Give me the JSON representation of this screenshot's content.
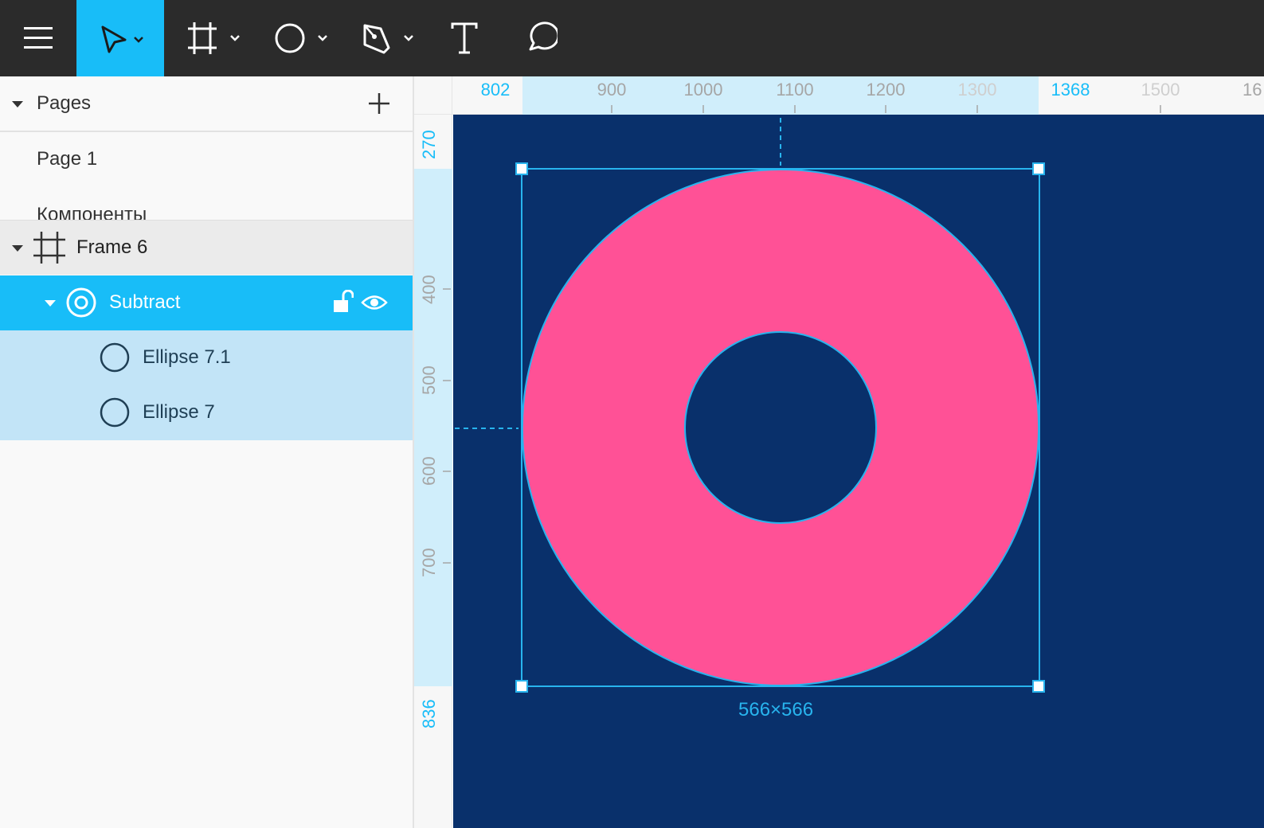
{
  "toolbar": {
    "tools": [
      {
        "name": "menu-icon"
      },
      {
        "name": "move-tool-icon",
        "active": true
      },
      {
        "name": "frame-tool-icon"
      },
      {
        "name": "ellipse-tool-icon"
      },
      {
        "name": "pen-tool-icon"
      },
      {
        "name": "text-tool-icon"
      },
      {
        "name": "comment-tool-icon"
      }
    ]
  },
  "sidebar": {
    "pages_title": "Pages",
    "pages": [
      "Page 1",
      "Компоненты"
    ],
    "layers": [
      {
        "label": "Frame 6",
        "icon": "frame-icon"
      },
      {
        "label": "Subtract",
        "icon": "subtract-icon",
        "selected": true
      },
      {
        "label": "Ellipse 7.1",
        "icon": "ellipse-icon"
      },
      {
        "label": "Ellipse 7",
        "icon": "ellipse-icon"
      }
    ]
  },
  "rulers": {
    "top": [
      "802",
      "900",
      "1000",
      "1100",
      "1200",
      "1300",
      "1368",
      "1500",
      "16"
    ],
    "left": [
      "270",
      "400",
      "500",
      "600",
      "700",
      "836"
    ]
  },
  "canvas": {
    "size_label": "566×566",
    "colors": {
      "background": "#09306b",
      "shape": "#ff5196",
      "selection": "#28b4ee",
      "accent": "#18bdf8"
    }
  }
}
